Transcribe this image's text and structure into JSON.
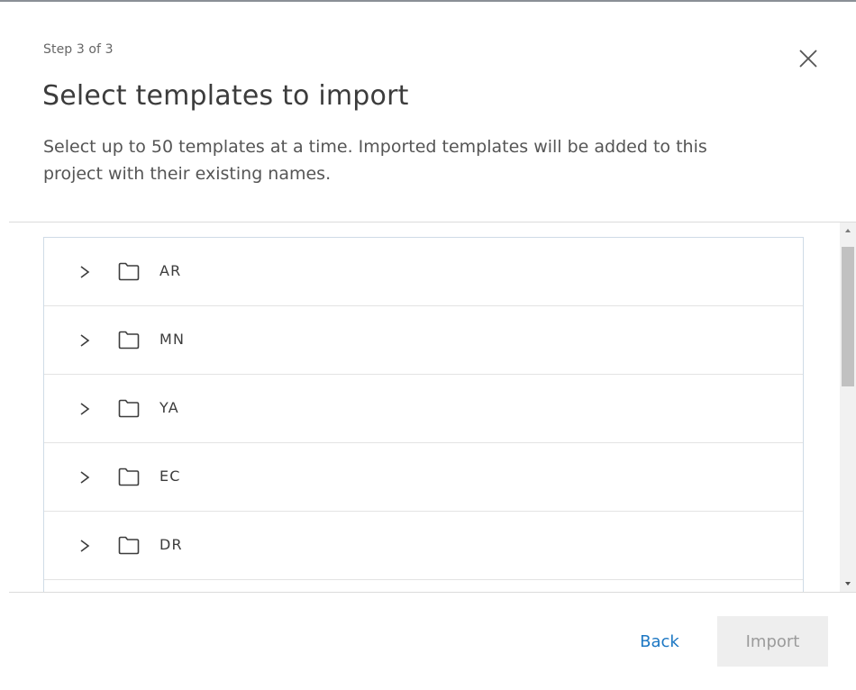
{
  "dialog": {
    "step_label": "Step 3 of 3",
    "title": "Select templates to import",
    "description": "Select up to 50 templates at a time. Imported templates will be added to this project with their existing names.",
    "close_icon": "close-icon"
  },
  "folders": [
    {
      "label": "AR",
      "icon": "folder-icon",
      "expander": "chevron-right-icon"
    },
    {
      "label": "MN",
      "icon": "folder-icon",
      "expander": "chevron-right-icon"
    },
    {
      "label": "YA",
      "icon": "folder-icon",
      "expander": "chevron-right-icon"
    },
    {
      "label": "EC",
      "icon": "folder-icon",
      "expander": "chevron-right-icon"
    },
    {
      "label": "DR",
      "icon": "folder-icon",
      "expander": "chevron-right-icon"
    }
  ],
  "footer": {
    "back_label": "Back",
    "import_label": "Import",
    "import_disabled": true
  },
  "colors": {
    "accent": "#1c77c3",
    "text": "#3c3c3c",
    "disabled_bg": "#eeeeee",
    "disabled_text": "#9b9b9b"
  }
}
